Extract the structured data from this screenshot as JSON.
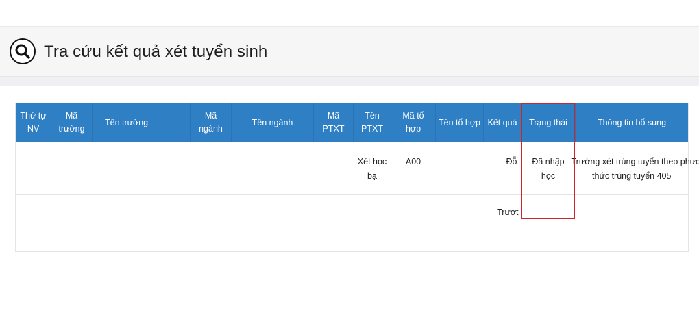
{
  "header": {
    "title": "Tra cứu kết quả xét tuyển sinh",
    "icon": "search-icon"
  },
  "table": {
    "columns": [
      "Thứ tự NV",
      "Mã trường",
      "Tên trường",
      "Mã ngành",
      "Tên ngành",
      "Mã PTXT",
      "Tên PTXT",
      "Mã tổ hợp",
      "Tên tổ hợp",
      "Kết quả",
      "Trạng thái",
      "Thông tin bổ sung"
    ],
    "rows": [
      {
        "thu_tu_nv": "",
        "ma_truong": "",
        "ten_truong": "",
        "ma_nganh": "",
        "ten_nganh": "",
        "ma_ptxt": "",
        "ten_ptxt": "Xét học bạ",
        "ma_to_hop": "A00",
        "ten_to_hop": "",
        "ket_qua": "Đỗ",
        "trang_thai": "Đã nhập học",
        "thong_tin_bo_sung_line1": "Trường xét trúng tuyển theo phương",
        "thong_tin_bo_sung_line2": "thức trúng tuyển 405"
      },
      {
        "thu_tu_nv": "",
        "ma_truong": "",
        "ten_truong": "",
        "ma_nganh": "",
        "ten_nganh": "",
        "ma_ptxt": "",
        "ten_ptxt": "",
        "ma_to_hop": "",
        "ten_to_hop": "",
        "ket_qua": "Trượt",
        "trang_thai": "",
        "thong_tin_bo_sung": ""
      }
    ]
  },
  "colors": {
    "header_blue": "#2f7fc5",
    "highlight_red": "#d0242b"
  }
}
